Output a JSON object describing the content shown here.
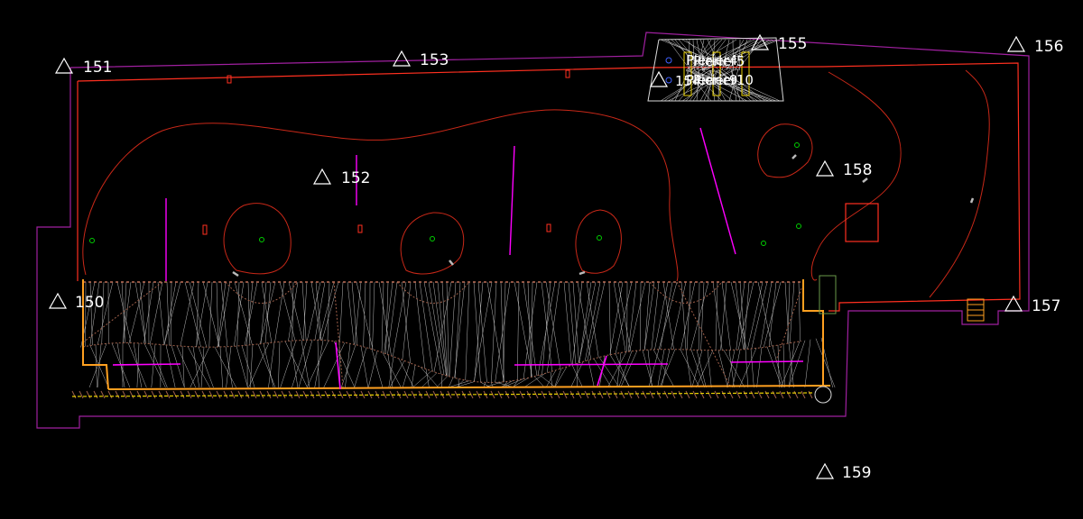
{
  "drawing": {
    "background": "#000000",
    "colors": {
      "boundary": "#a020a0",
      "contour": "#ff2a1a",
      "outline_red": "#ff3020",
      "mesh": "#d8d8d8",
      "mesh_brown": "#a0604a",
      "break_line": "#ff00ff",
      "edge_orange": "#ffa020",
      "edge_yellow": "#e8d000",
      "marker_green": "#00d000",
      "marker_blue": "#4060ff",
      "label": "#ffffff"
    },
    "stations": [
      {
        "id": "150",
        "label": "150"
      },
      {
        "id": "151",
        "label": "151"
      },
      {
        "id": "152",
        "label": "152"
      },
      {
        "id": "153",
        "label": "153"
      },
      {
        "id": "155",
        "label": "155"
      },
      {
        "id": "156",
        "label": "156"
      },
      {
        "id": "157",
        "label": "157"
      },
      {
        "id": "158",
        "label": "158"
      },
      {
        "id": "159",
        "label": "159"
      }
    ],
    "overlapping_labels": [
      {
        "id": "pier-a",
        "text": "Pierier4"
      },
      {
        "id": "pier-b",
        "text": "Pierier5"
      },
      {
        "id": "pier-c",
        "text": "Pierier9"
      },
      {
        "id": "pier-d",
        "text": "Pierier10"
      },
      {
        "id": "station-154",
        "text": "154"
      }
    ]
  }
}
